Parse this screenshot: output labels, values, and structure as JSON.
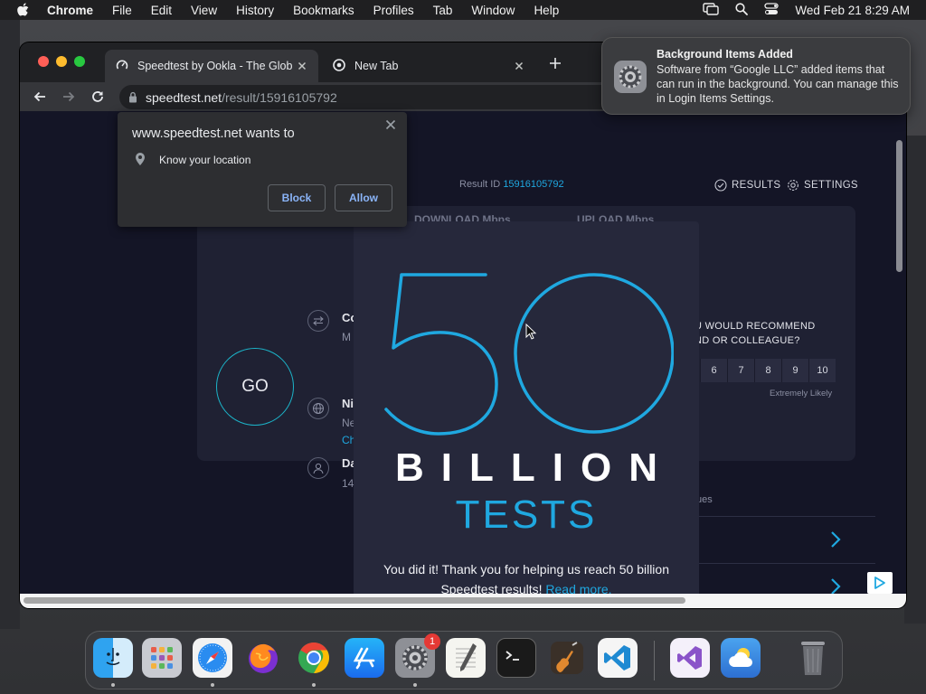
{
  "menubar": {
    "app": "Chrome",
    "items": [
      "File",
      "Edit",
      "View",
      "History",
      "Bookmarks",
      "Profiles",
      "Tab",
      "Window",
      "Help"
    ],
    "datetime": "Wed Feb 21  8:29 AM"
  },
  "browser": {
    "tabs": [
      {
        "title": "Speedtest by Ookla - The Glob"
      },
      {
        "title": "New Tab"
      }
    ],
    "url_host": "speedtest.net",
    "url_path": "/result/15916105792"
  },
  "permission": {
    "title": "www.speedtest.net wants to",
    "request": "Know your location",
    "block_label": "Block",
    "allow_label": "Allow"
  },
  "notification": {
    "title": "Background Items Added",
    "body": "Software from “Google LLC” added items that can run in the background. You can manage this in Login Items Settings."
  },
  "page": {
    "result_label": "Result ID",
    "result_id": "15916105792",
    "results_link": "RESULTS",
    "settings_link": "SETTINGS",
    "download_label": "DOWNLOAD Mbps",
    "upload_label": "UPLOAD Mbps",
    "go_label": "GO",
    "side": {
      "item1_title": "Co",
      "item1_sub": "M",
      "item2_title": "Ni",
      "item2_sub": "Ne",
      "item2_link": "Ch",
      "item3_title": "Da",
      "item3_sub": "14"
    },
    "recommend_line1": "U WOULD RECOMMEND",
    "recommend_line2": "ND OR COLLEAGUE?",
    "scale": [
      "6",
      "7",
      "8",
      "9",
      "10"
    ],
    "likely_label": "Extremely Likely",
    "ues_label": "ues"
  },
  "promo": {
    "number": "50",
    "billion": "BILLION",
    "tests": "TESTS",
    "message": "You did it! Thank you for helping us reach 50 billion Speedtest results!",
    "read_more": "Read more."
  },
  "colors": {
    "accent": "#1fa8e0",
    "go_ring": "#1cb4c9",
    "page_bg": "#141526"
  },
  "dock": {
    "apps": [
      "finder-icon",
      "launchpad-icon",
      "safari-icon",
      "firefox-icon",
      "chrome-icon",
      "app-store-icon",
      "system-settings-icon",
      "textedit-icon",
      "terminal-icon",
      "garageband-icon",
      "vscode-icon",
      "visual-studio-icon",
      "weather-icon",
      "trash-icon"
    ],
    "settings_badge": "1"
  }
}
